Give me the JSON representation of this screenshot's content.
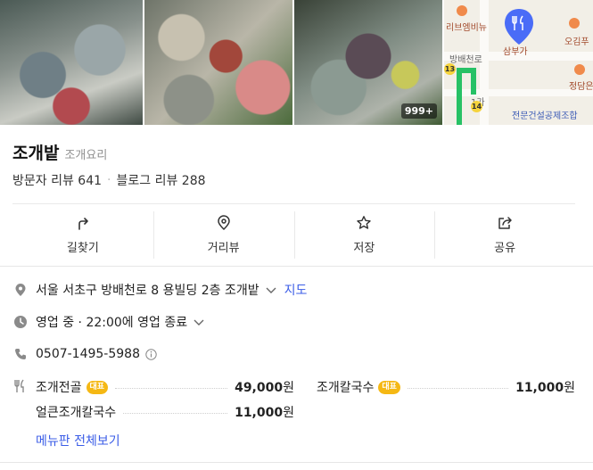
{
  "photos": {
    "count_badge": "999+"
  },
  "map": {
    "labels": {
      "poi_left": "리브엠비뉴",
      "poi_right": "오김푸",
      "place": "삼부가",
      "poi_far": "정담은",
      "road": "방배천로",
      "road_mid": "1가",
      "org": "전문건설공제조합"
    },
    "route_numbers": [
      "13",
      "14"
    ]
  },
  "place": {
    "name": "조개밭",
    "category": "조개요리",
    "visitor_reviews": "방문자 리뷰 641",
    "blog_reviews": "블로그 리뷰 288"
  },
  "actions": [
    {
      "label": "길찾기",
      "icon": "directions-icon"
    },
    {
      "label": "거리뷰",
      "icon": "street-view-icon"
    },
    {
      "label": "저장",
      "icon": "star-icon"
    },
    {
      "label": "공유",
      "icon": "share-icon"
    }
  ],
  "info": {
    "address": "서울 서초구 방배천로 8 용빌딩 2층 조개밭",
    "map_link": "지도",
    "hours": "영업 중 · 22:00에 영업 종료",
    "phone": "0507-1495-5988"
  },
  "menu": {
    "items": [
      {
        "name": "조개전골",
        "rep": "대표",
        "price": "49,000",
        "unit": "원"
      },
      {
        "name": "조개칼국수",
        "rep": "대표",
        "price": "11,000",
        "unit": "원"
      },
      {
        "name": "얼큰조개칼국수",
        "rep": "",
        "price": "11,000",
        "unit": "원"
      }
    ],
    "see_all": "메뉴판 전체보기"
  },
  "colors": {
    "link": "#3b5de7",
    "rep_badge": "#f5b814",
    "map_pin": "#4a6cf7"
  }
}
